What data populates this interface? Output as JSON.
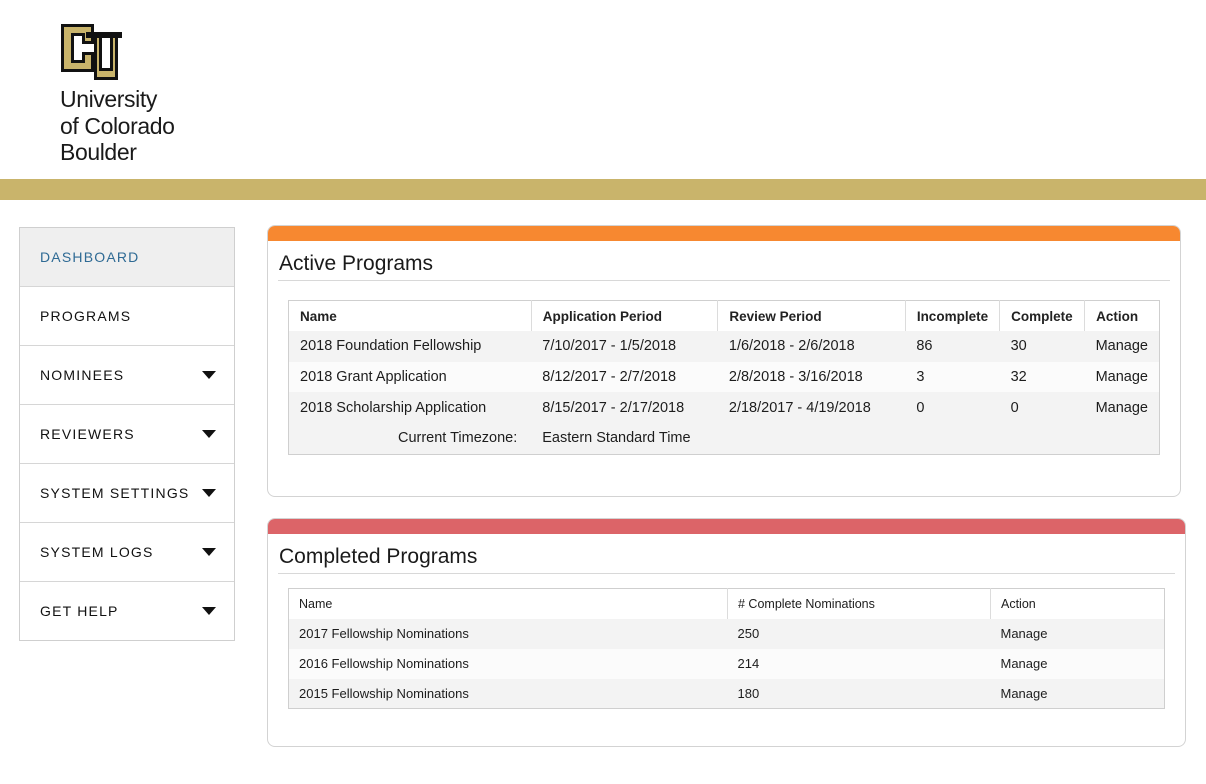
{
  "brand": {
    "logo_icon": "cu-logo",
    "line1": "University",
    "line2": "of Colorado",
    "line3": "Boulder",
    "colors": {
      "gold": "#c9b46b",
      "black": "#111111"
    }
  },
  "sidebar": {
    "items": [
      {
        "label": "DASHBOARD",
        "active": true,
        "has_caret": false
      },
      {
        "label": "PROGRAMS",
        "active": false,
        "has_caret": false
      },
      {
        "label": "NOMINEES",
        "active": false,
        "has_caret": true
      },
      {
        "label": "REVIEWERS",
        "active": false,
        "has_caret": true
      },
      {
        "label": "SYSTEM SETTINGS",
        "active": false,
        "has_caret": true
      },
      {
        "label": "SYSTEM LOGS",
        "active": false,
        "has_caret": true
      },
      {
        "label": "GET HELP",
        "active": false,
        "has_caret": true
      }
    ]
  },
  "active_programs": {
    "title": "Active Programs",
    "accent": "#f78830",
    "headers": [
      "Name",
      "Application Period",
      "Review Period",
      "Incomplete",
      "Complete",
      "Action"
    ],
    "rows": [
      {
        "name": "2018 Foundation Fellowship",
        "application_period": "7/10/2017 - 1/5/2018",
        "review_period": "1/6/2018 - 2/6/2018",
        "incomplete": "86",
        "complete": "30",
        "action": "Manage"
      },
      {
        "name": "2018 Grant Application",
        "application_period": "8/12/2017 - 2/7/2018",
        "review_period": "2/8/2018 - 3/16/2018",
        "incomplete": "3",
        "complete": "32",
        "action": "Manage"
      },
      {
        "name": "2018 Scholarship Application",
        "application_period": "8/15/2017 - 2/17/2018",
        "review_period": "2/18/2017 - 4/19/2018",
        "incomplete": "0",
        "complete": "0",
        "action": "Manage"
      }
    ],
    "timezone_label": "Current Timezone:",
    "timezone_value": "Eastern Standard Time"
  },
  "completed_programs": {
    "title": "Completed Programs",
    "accent": "#dc6468",
    "headers": [
      "Name",
      "# Complete Nominations",
      "Action"
    ],
    "rows": [
      {
        "name": "2017 Fellowship Nominations",
        "count": "250",
        "action": "Manage"
      },
      {
        "name": "2016 Fellowship Nominations",
        "count": "214",
        "action": "Manage"
      },
      {
        "name": "2015 Fellowship Nominations",
        "count": "180",
        "action": "Manage"
      }
    ]
  },
  "link_color": "#3f84c7"
}
